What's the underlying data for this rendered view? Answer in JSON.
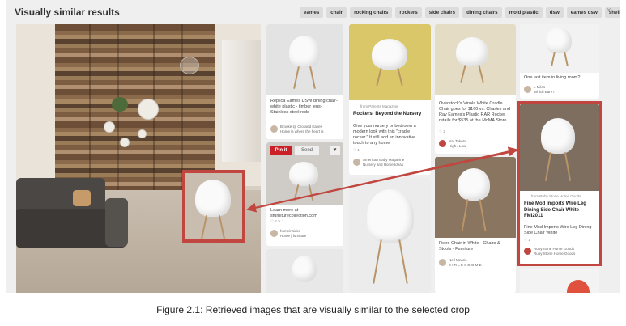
{
  "header": {
    "title": "Visually similar results",
    "tags": [
      "eames",
      "chair",
      "rocking chairs",
      "rockers",
      "side chairs",
      "dining chairs",
      "mold plastic",
      "dsw",
      "eames dsw",
      "shell chair"
    ],
    "close_glyph": "×"
  },
  "pins": {
    "p1": {
      "title": "Replica Eames DSW dining chair- white plastic - timber legs- Stainless steel rods",
      "user": "Brooke @ Crossed Eaves",
      "board": "Home is where the heart is"
    },
    "p2": {
      "pin_label": "Pin it",
      "send_label": "Send",
      "heart_glyph": "♥",
      "title": "Learn more at sfurniturecollection.com",
      "meta": "♡ 2  ✎ 1",
      "user": "homeinsider",
      "board": "Home | furniture"
    },
    "p3": {
      "source": "from Parents Magazine",
      "title": "Rockers: Beyond the Nursery",
      "desc": "Give your nursery or bedroom a modern look with this \"cradle rocker.\" It still add an innovative touch to any home",
      "meta": "♡ 1",
      "user": "American Baby Magazine",
      "board": "Nursery and Home Ideas"
    },
    "p4": {
      "desc": "Overstock's Vinola White Cradle Chair goes for $160 vs. Charles and Ray Eames's Plastic RAR Rocker retails for $535 at the MoMA Store",
      "meta": "♡ 2",
      "user": "Nat Taketo",
      "board": "High / Low"
    },
    "p5": {
      "title": "Retro Chair in White - Chairs & Stools - Furniture",
      "user": "Nell Mearie",
      "board": "E I R L E S D O M E"
    },
    "p6": {
      "desc": "One last item in living room?",
      "user": "L Miles",
      "board": "Which Eare?"
    },
    "p7": {
      "source": "from Ruby Stone Home Goods",
      "title": "Fine Mod Imports Wire Leg Dining Side Chair White FMI2011",
      "desc": "Fine Mod Imports Wire Leg Dining Side Chair White",
      "meta": "♡ 1",
      "user": "RubyStone Home Goods",
      "board": "Ruby Stone Home Goods"
    }
  },
  "caption": "Figure 2.1: Retrieved images that are visually similar to the selected crop"
}
